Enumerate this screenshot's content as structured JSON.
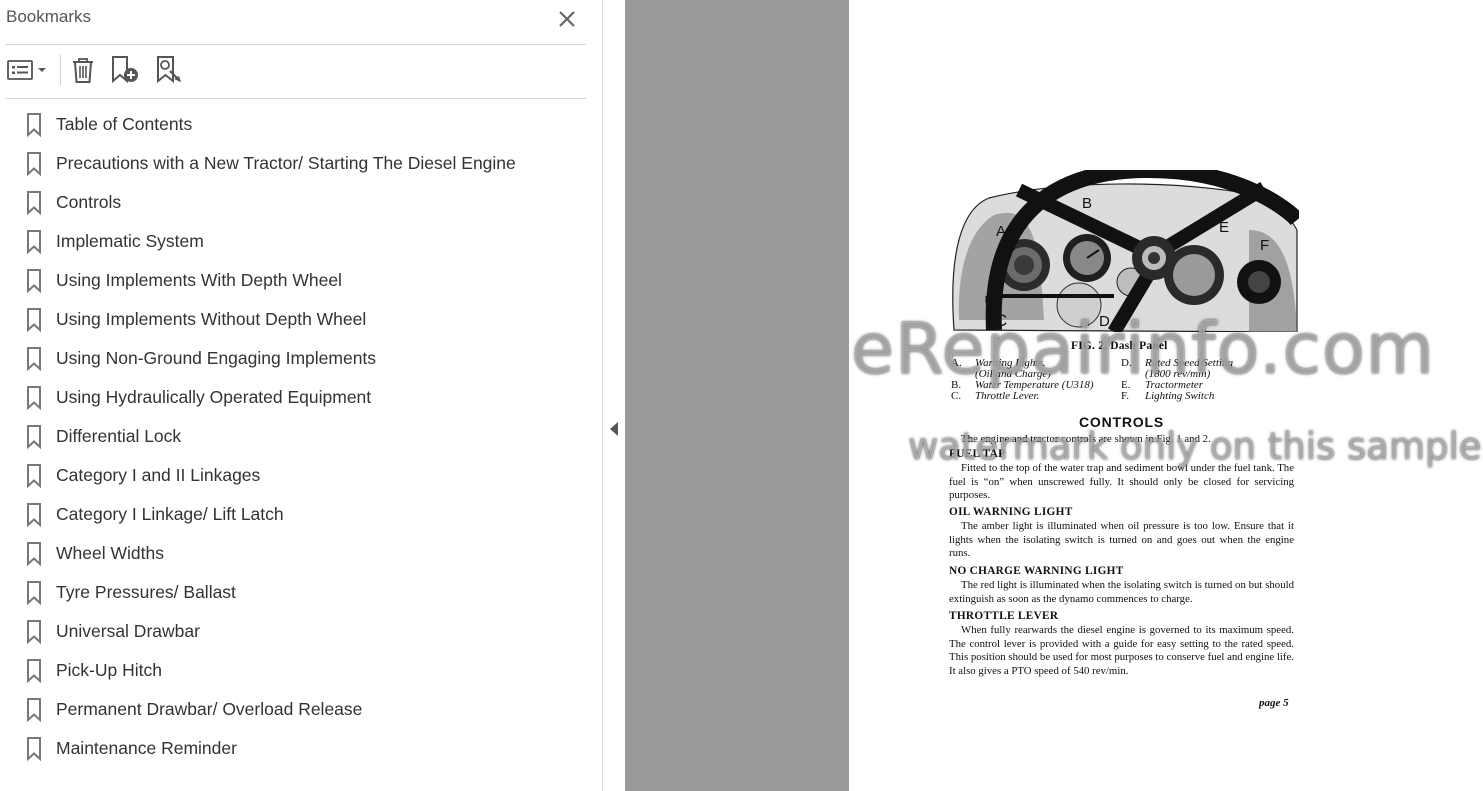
{
  "bookmarks_panel": {
    "title": "Bookmarks",
    "items": [
      {
        "label": "Table of Contents"
      },
      {
        "label": "Precautions with a New Tractor/ Starting The Diesel Engine"
      },
      {
        "label": "Controls"
      },
      {
        "label": "Implematic System"
      },
      {
        "label": "Using Implements With Depth Wheel"
      },
      {
        "label": "Using Implements Without Depth Wheel"
      },
      {
        "label": "Using Non-Ground Engaging Implements"
      },
      {
        "label": "Using Hydraulically Operated Equipment"
      },
      {
        "label": "Differential Lock"
      },
      {
        "label": "Category I and II Linkages"
      },
      {
        "label": "Category I Linkage/ Lift Latch"
      },
      {
        "label": "Wheel Widths"
      },
      {
        "label": "Tyre Pressures/ Ballast"
      },
      {
        "label": "Universal Drawbar"
      },
      {
        "label": "Pick-Up Hitch"
      },
      {
        "label": "Permanent Drawbar/ Overload Release"
      },
      {
        "label": "Maintenance Reminder"
      }
    ]
  },
  "page": {
    "figure_labels": {
      "a": "A",
      "b": "B",
      "c": "C",
      "d": "D",
      "e": "E",
      "f": "F"
    },
    "figure_title": "FIG. 2.   Dash Panel",
    "legend_left": [
      {
        "key": "A.",
        "text": "Warning Lights."
      },
      {
        "key": "",
        "text": "(Oil and Charge)"
      },
      {
        "key": "B.",
        "text": "Water Temperature (U318)"
      },
      {
        "key": "C.",
        "text": "Throttle Lever."
      }
    ],
    "legend_right": [
      {
        "key": "D.",
        "text": "Rated Speed Setting"
      },
      {
        "key": "",
        "text": "(1800 rev/min)"
      },
      {
        "key": "E.",
        "text": "Tractormeter"
      },
      {
        "key": "F.",
        "text": "Lighting Switch"
      }
    ],
    "heading": "CONTROLS",
    "intro": "The engine and tractor controls are shown in Fig. 1 and 2.",
    "sections": [
      {
        "title": "FUEL TAP",
        "text": "Fitted to the top of the water trap and sediment bowl under the fuel tank.  The fuel is “on” when unscrewed fully.  It should only be closed for servicing purposes."
      },
      {
        "title": "OIL WARNING LIGHT",
        "text": "The amber light is illuminated when oil pressure is too low. Ensure that it lights when the isolating switch is turned on and goes out when the engine runs."
      },
      {
        "title": "NO CHARGE WARNING LIGHT",
        "text": "The red light is illuminated when the isolating switch is turned on but should extinguish as soon as the dynamo commences to charge."
      },
      {
        "title": "THROTTLE LEVER",
        "text": "When fully rearwards the diesel engine is governed to its maximum speed.  The control lever is provided with a guide for easy setting to the rated speed.  This position should be used for most purposes to conserve fuel and engine life.  It also gives a PTO speed of 540 rev/min."
      }
    ],
    "page_number": "page 5"
  },
  "watermarks": {
    "line1": "eRepairinfo.com",
    "line2": "watermark only on this sample"
  }
}
